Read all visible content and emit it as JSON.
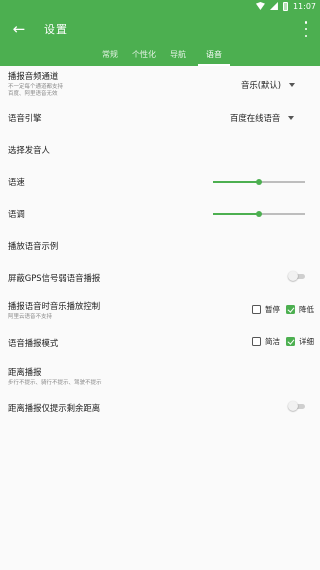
{
  "status": {
    "time": "11:07"
  },
  "toolbar": {
    "title": "设置"
  },
  "tabs": [
    {
      "label": "常规",
      "active": false
    },
    {
      "label": "个性化",
      "active": false
    },
    {
      "label": "导航",
      "active": false
    },
    {
      "label": "语音",
      "active": true
    }
  ],
  "settings": {
    "channel": {
      "label": "播报音频通道",
      "sub1": "不一定每个通道都支持",
      "sub2": "百度、阿里语音无效",
      "value": "音乐(默认)"
    },
    "engine": {
      "label": "语音引擎",
      "value": "百度在线语音"
    },
    "speaker": {
      "label": "选择发音人"
    },
    "speed": {
      "label": "语速",
      "level": 0.5
    },
    "pitch": {
      "label": "语调",
      "level": 0.5
    },
    "sample": {
      "label": "播放语音示例"
    },
    "gps_weak": {
      "label": "屏蔽GPS信号弱语音播报",
      "on": false
    },
    "music_control": {
      "label": "播报语音时音乐播放控制",
      "sub": "阿里云语音不支持",
      "options": [
        {
          "label": "暂停",
          "checked": false
        },
        {
          "label": "降低",
          "checked": true
        }
      ]
    },
    "mode": {
      "label": "语音播报模式",
      "options": [
        {
          "label": "简洁",
          "checked": false
        },
        {
          "label": "详细",
          "checked": true
        }
      ]
    },
    "distance": {
      "label": "距离播报",
      "sub": "步行不提示、骑行不提示、驾驶不提示"
    },
    "remaining_only": {
      "label": "距离播报仅提示剩余距离",
      "on": false
    }
  },
  "colors": {
    "accent": "#4caf50"
  }
}
